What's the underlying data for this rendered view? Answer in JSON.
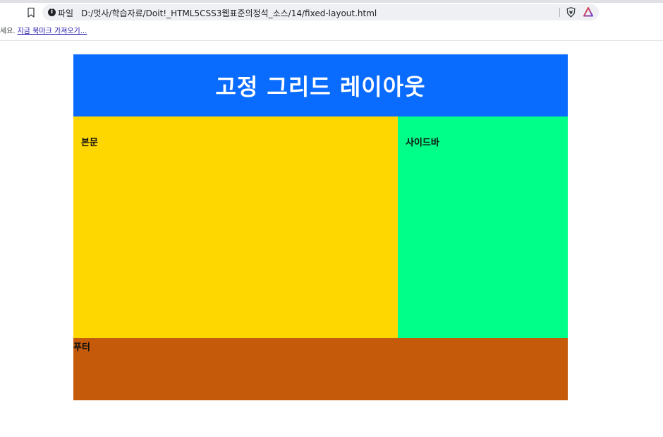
{
  "browser": {
    "scheme_label": "파일",
    "url": "D:/멋사/학습자료/Doit!_HTML5CSS3웹표준의정석_소스/14/fixed-layout.html",
    "icons": [
      "bookmark-star-icon",
      "info-icon",
      "brave-shield-icon",
      "brave-rewards-icon"
    ]
  },
  "bookmarks_bar": {
    "prefix_text": "세요.",
    "import_link": "지금 북마크 가져오기..."
  },
  "layout": {
    "header_title": "고정 그리드 레이아웃",
    "main_label": "본문",
    "sidebar_label": "사이드바",
    "footer_label": "푸터"
  },
  "colors": {
    "header": "#0a6cff",
    "main": "#ffd700",
    "sidebar": "#00ff88",
    "footer": "#c55a0a"
  }
}
